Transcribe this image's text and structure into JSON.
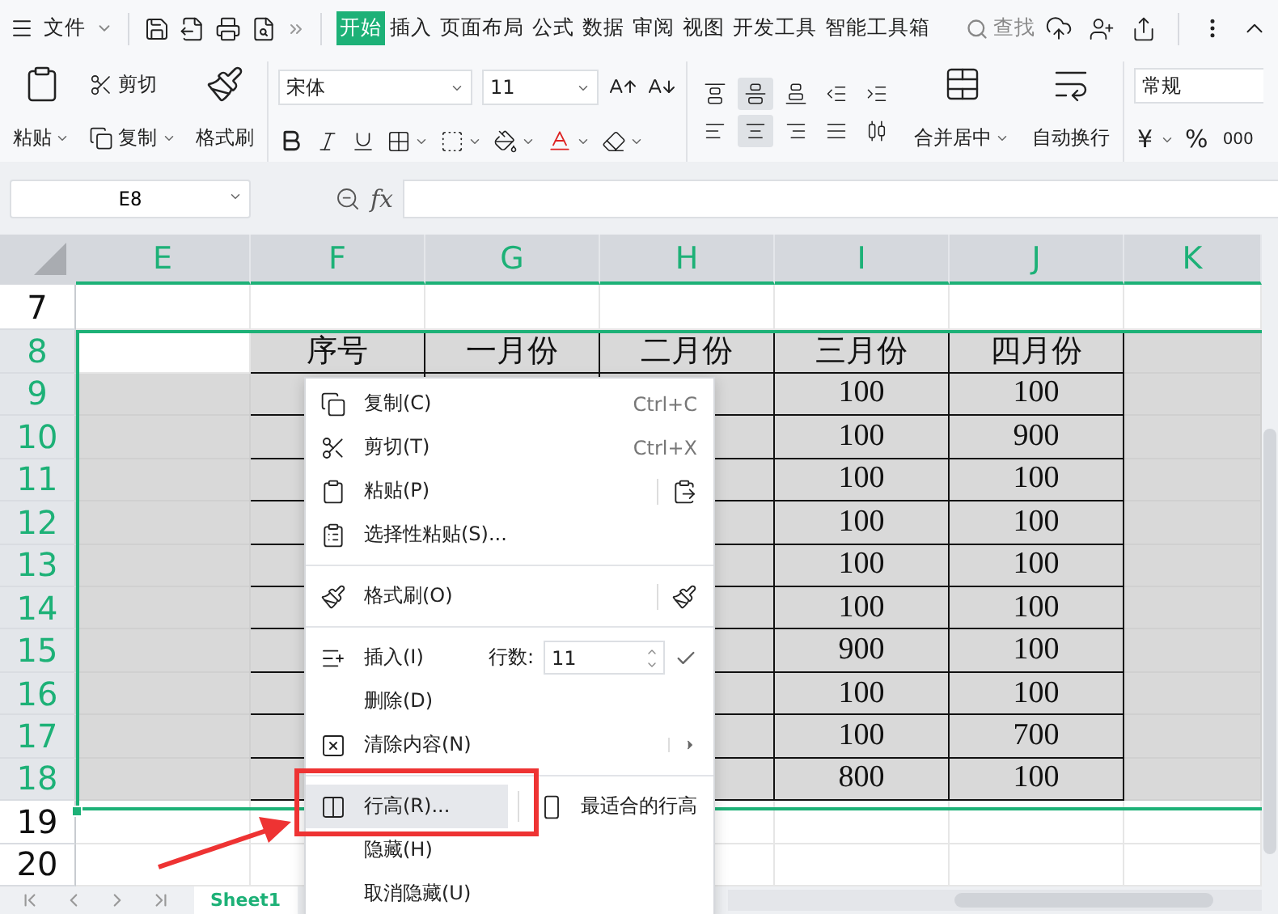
{
  "menubar": {
    "file_menu": "文件",
    "tabs": [
      {
        "label": "开始",
        "selected": true
      },
      {
        "label": "插入",
        "selected": false
      },
      {
        "label": "页面布局",
        "selected": false
      },
      {
        "label": "公式",
        "selected": false
      },
      {
        "label": "数据",
        "selected": false
      },
      {
        "label": "审阅",
        "selected": false
      },
      {
        "label": "视图",
        "selected": false
      },
      {
        "label": "开发工具",
        "selected": false
      },
      {
        "label": "智能工具箱",
        "selected": false
      }
    ],
    "search": "查找"
  },
  "ribbon": {
    "clipboard": {
      "paste": "粘贴",
      "cut": "剪切",
      "copy": "复制",
      "format_painter": "格式刷"
    },
    "font": {
      "name": "宋体",
      "size": "11"
    },
    "alignment_buttons": [
      {
        "on": false
      },
      {
        "on": true
      },
      {
        "on": false
      },
      {
        "on": false
      },
      {
        "on": false
      },
      {
        "on": false
      },
      {
        "on": true
      },
      {
        "on": false
      },
      {
        "on": false
      },
      {
        "on": false
      }
    ],
    "merge": "合并居中",
    "wrap": "自动换行",
    "number": {
      "format": "常规",
      "currency": "¥",
      "percent": "%",
      "thousands": "000"
    }
  },
  "formula_bar": {
    "cell_ref": "E8",
    "fx": "fx"
  },
  "sheet": {
    "columns": [
      {
        "label": "E",
        "selected": true
      },
      {
        "label": "F",
        "selected": true
      },
      {
        "label": "G",
        "selected": true
      },
      {
        "label": "H",
        "selected": true
      },
      {
        "label": "I",
        "selected": true
      },
      {
        "label": "J",
        "selected": true
      },
      {
        "label": "K",
        "selected": true
      }
    ],
    "rows": [
      {
        "label": "7",
        "selected": false
      },
      {
        "label": "8",
        "selected": true
      },
      {
        "label": "9",
        "selected": true
      },
      {
        "label": "10",
        "selected": true
      },
      {
        "label": "11",
        "selected": true
      },
      {
        "label": "12",
        "selected": true
      },
      {
        "label": "13",
        "selected": true
      },
      {
        "label": "14",
        "selected": true
      },
      {
        "label": "15",
        "selected": true
      },
      {
        "label": "16",
        "selected": true
      },
      {
        "label": "17",
        "selected": true
      },
      {
        "label": "18",
        "selected": true
      },
      {
        "label": "19",
        "selected": false
      },
      {
        "label": "20",
        "selected": false
      }
    ],
    "table": {
      "header": [
        "序号",
        "一月份",
        "二月份",
        "三月份",
        "四月份"
      ],
      "visible_values": [
        [
          "100",
          "100"
        ],
        [
          "100",
          "900"
        ],
        [
          "100",
          "100"
        ],
        [
          "100",
          "100"
        ],
        [
          "100",
          "100"
        ],
        [
          "100",
          "100"
        ],
        [
          "900",
          "100"
        ],
        [
          "100",
          "100"
        ],
        [
          "100",
          "700"
        ],
        [
          "800",
          "100"
        ]
      ]
    }
  },
  "context_menu": [
    {
      "kind": "item",
      "label": "复制(C)",
      "shortcut": "Ctrl+C",
      "selected": false
    },
    {
      "kind": "item",
      "label": "剪切(T)",
      "shortcut": "Ctrl+X",
      "selected": false
    },
    {
      "kind": "side",
      "label": "粘贴(P)",
      "selected": false
    },
    {
      "kind": "item",
      "label": "选择性粘贴(S)...",
      "selected": false
    },
    {
      "kind": "separator"
    },
    {
      "kind": "side",
      "label": "格式刷(O)",
      "selected": false
    },
    {
      "kind": "separator"
    },
    {
      "kind": "insert",
      "label": "插入(I)",
      "count_label": "行数:",
      "count": "11",
      "selected": false
    },
    {
      "kind": "item",
      "label": "删除(D)",
      "selected": false
    },
    {
      "kind": "submenu",
      "label": "清除内容(N)",
      "selected": false
    },
    {
      "kind": "separator"
    },
    {
      "kind": "split",
      "label": "行高(R)...",
      "side_label": "最适合的行高",
      "selected": true
    },
    {
      "kind": "item",
      "label": "隐藏(H)",
      "selected": false
    },
    {
      "kind": "item",
      "label": "取消隐藏(U)",
      "selected": false
    }
  ],
  "sheet_tabs": [
    {
      "label": "Sheet1",
      "selected": true
    }
  ]
}
